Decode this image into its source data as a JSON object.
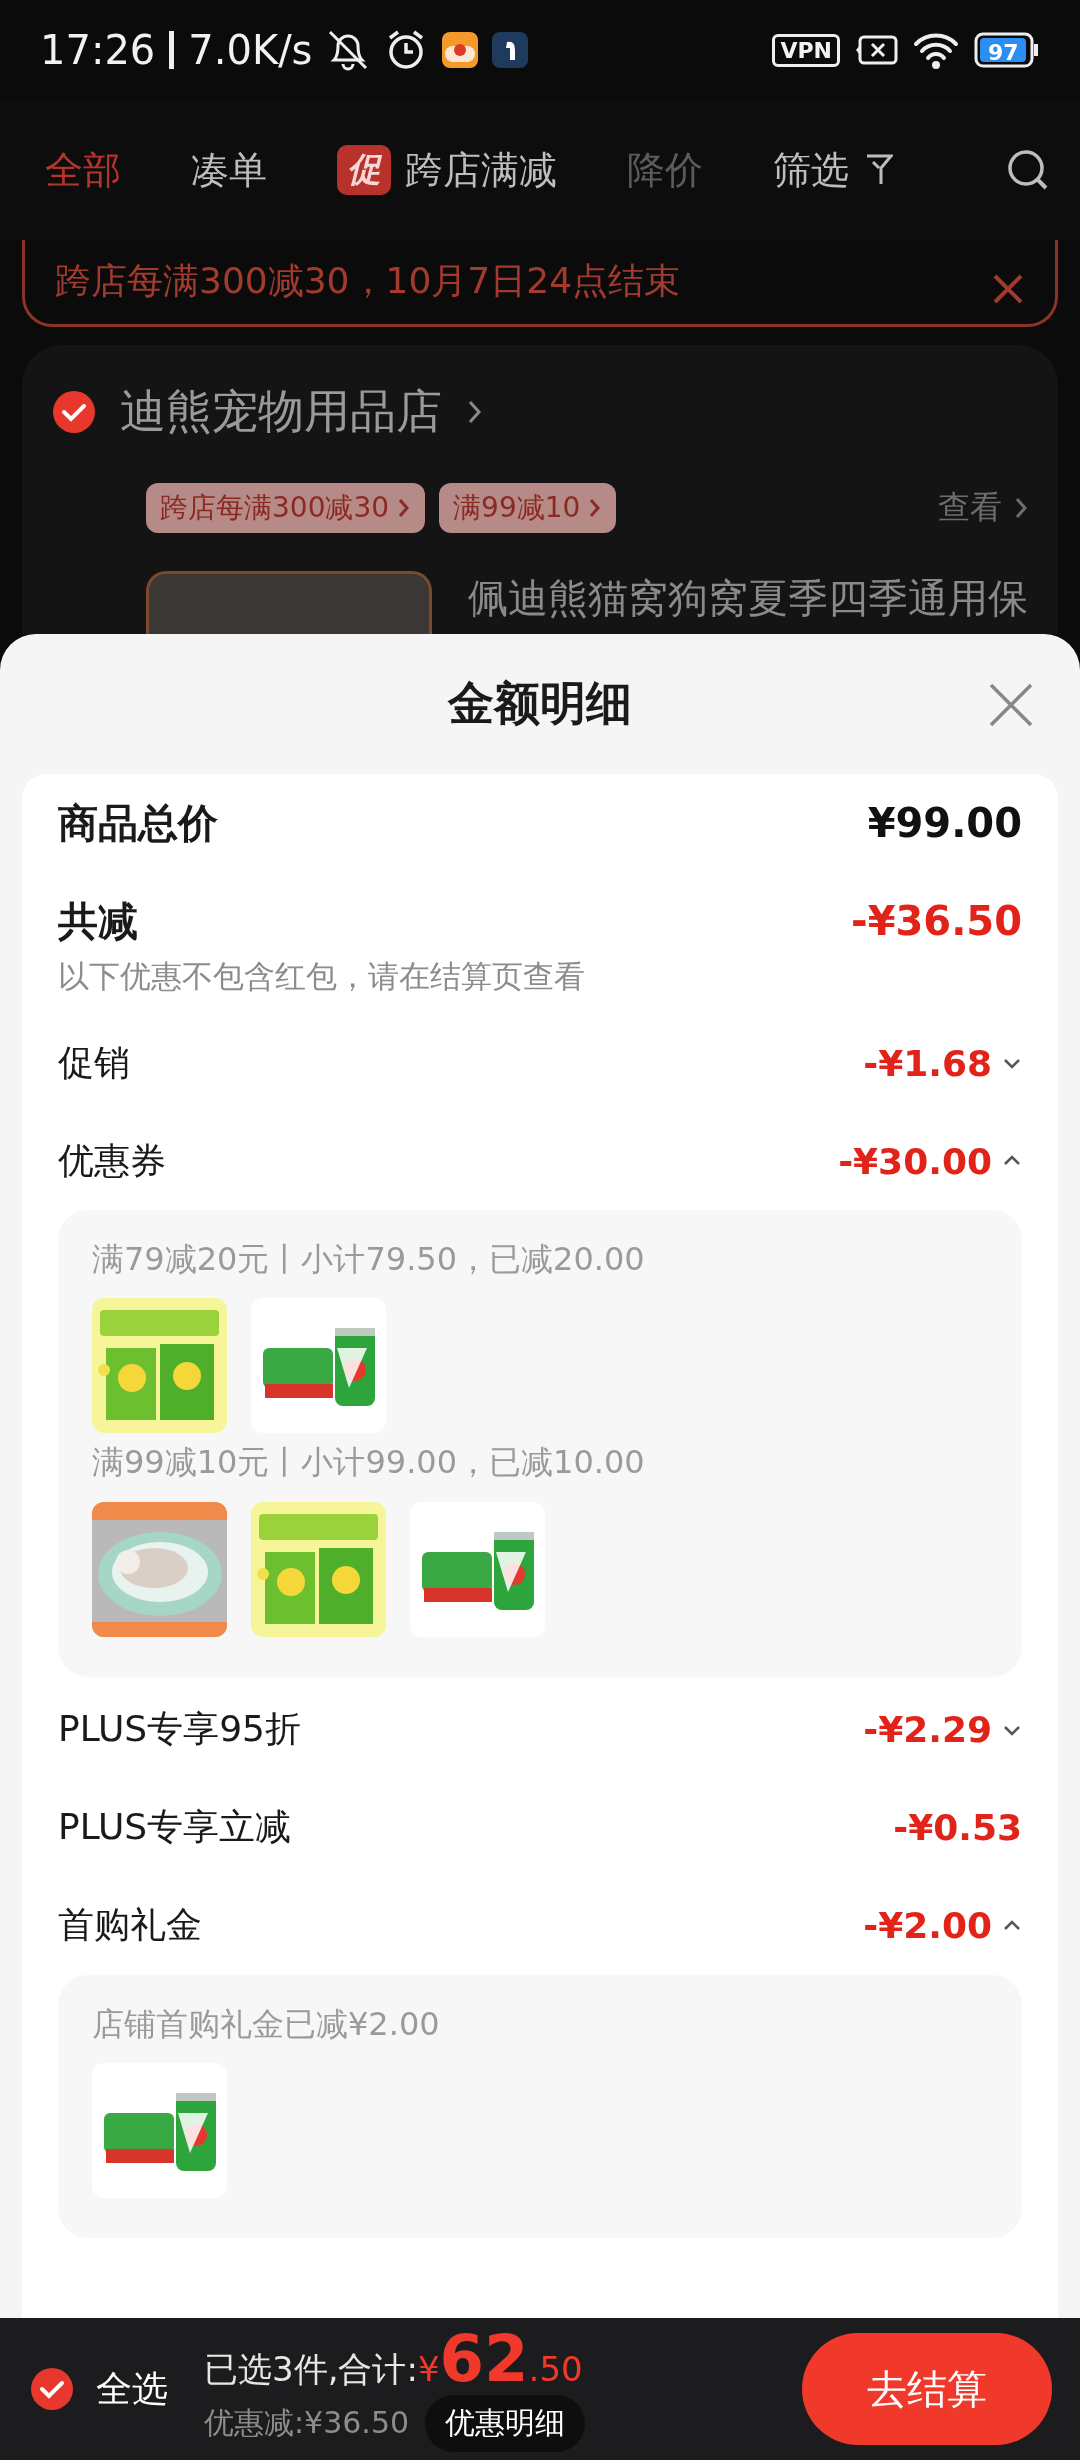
{
  "status_bar": {
    "time": "17:26",
    "net_speed": "7.0K/s",
    "vpn": "VPN",
    "battery": "97"
  },
  "tabs": [
    {
      "label": "全部",
      "selected": true,
      "disabled": false
    },
    {
      "label": "凑单",
      "selected": false,
      "disabled": false
    },
    {
      "label": "跨店满减",
      "badge": "促",
      "selected": false,
      "disabled": false
    },
    {
      "label": "降价",
      "selected": false,
      "disabled": true
    },
    {
      "label": "筛选",
      "selected": false,
      "disabled": false
    }
  ],
  "banner": {
    "text": "跨店每满300减30，10月7日24点结束"
  },
  "store": {
    "name": "迪熊宠物用品店",
    "checked": true,
    "tags": [
      "跨店每满300减30",
      "满99减10"
    ],
    "view": "查看",
    "product_title": "佩迪熊猫窝狗窝夏季四季通用保"
  },
  "sheet": {
    "title": "金额明细",
    "total": {
      "label": "商品总价",
      "amount": "¥99.00"
    },
    "reduction": {
      "label": "共减",
      "amount": "-¥36.50",
      "note": "以下优惠不包含红包，请在结算页查看"
    },
    "rows": [
      {
        "kind": "toggle",
        "label": "促销",
        "amount": "-¥1.68",
        "expanded": false
      },
      {
        "kind": "toggle",
        "label": "优惠券",
        "amount": "-¥30.00",
        "expanded": true,
        "details": [
          {
            "text": "满79减20元丨小计79.50，已减20.00"
          },
          {
            "text": "满99减10元丨小计99.00，已减10.00"
          }
        ]
      },
      {
        "kind": "toggle",
        "label": "PLUS专享95折",
        "amount": "-¥2.29",
        "expanded": false
      },
      {
        "kind": "plain",
        "label": "PLUS专享立减",
        "amount": "-¥0.53"
      },
      {
        "kind": "toggle",
        "label": "首购礼金",
        "amount": "-¥2.00",
        "expanded": true,
        "details": [
          {
            "text": "店铺首购礼金已减¥2.00"
          }
        ]
      }
    ]
  },
  "bottom_bar": {
    "select_all": {
      "label": "全选",
      "checked": true
    },
    "summary": "已选3件,合计:",
    "currency": "¥",
    "price_int": "62",
    "price_dec": ".50",
    "discount": "优惠减:¥36.50",
    "detail_button": "优惠明细",
    "checkout": "去结算"
  }
}
